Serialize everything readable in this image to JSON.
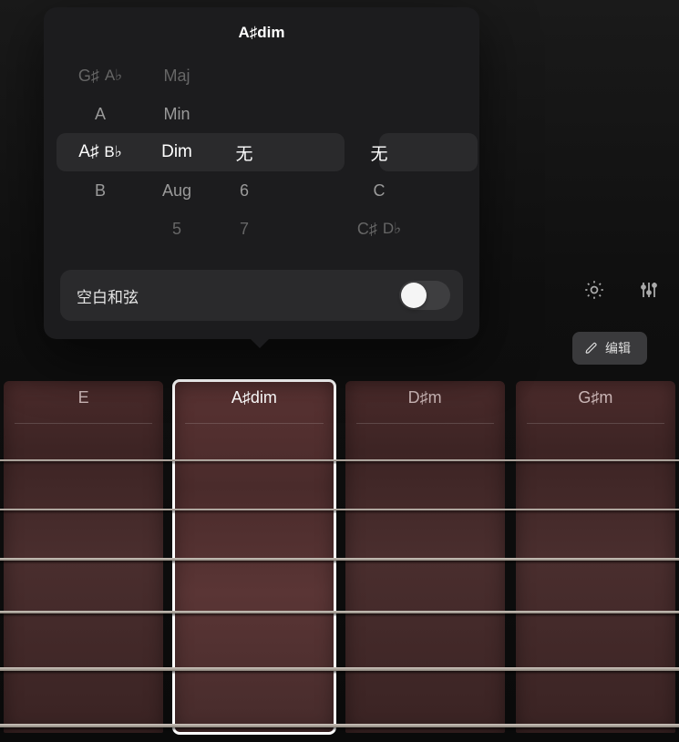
{
  "popover": {
    "title": "A♯dim",
    "root_picker": {
      "items": [
        {
          "label": "G♯",
          "enharmonic": "A♭",
          "state": "far"
        },
        {
          "label": "A",
          "enharmonic": "",
          "state": "near"
        },
        {
          "label": "A♯",
          "enharmonic": "B♭",
          "state": "selected"
        },
        {
          "label": "B",
          "enharmonic": "",
          "state": "near"
        }
      ]
    },
    "quality_picker": {
      "items": [
        {
          "label": "Maj",
          "state": "far"
        },
        {
          "label": "Min",
          "state": "near"
        },
        {
          "label": "Dim",
          "state": "selected"
        },
        {
          "label": "Aug",
          "state": "near"
        },
        {
          "label": "5",
          "state": "far"
        }
      ]
    },
    "extension_picker": {
      "items": [
        {
          "label": "",
          "state": "far"
        },
        {
          "label": "",
          "state": "near"
        },
        {
          "label": "无",
          "state": "selected"
        },
        {
          "label": "6",
          "state": "near"
        },
        {
          "label": "7",
          "state": "far"
        }
      ]
    },
    "bass_picker": {
      "items": [
        {
          "label": "",
          "enharmonic": "",
          "state": "far"
        },
        {
          "label": "",
          "enharmonic": "",
          "state": "near"
        },
        {
          "label": "无",
          "enharmonic": "",
          "state": "selected"
        },
        {
          "label": "C",
          "enharmonic": "",
          "state": "near"
        },
        {
          "label": "C♯",
          "enharmonic": "D♭",
          "state": "far"
        }
      ]
    }
  },
  "blank_chord": {
    "label": "空白和弦",
    "enabled": false
  },
  "toolbar": {
    "edit_label": "编辑"
  },
  "chord_strips": [
    {
      "name": "E",
      "active": false
    },
    {
      "name": "A♯dim",
      "active": true
    },
    {
      "name": "D♯m",
      "active": false
    },
    {
      "name": "G♯m",
      "active": false
    }
  ]
}
